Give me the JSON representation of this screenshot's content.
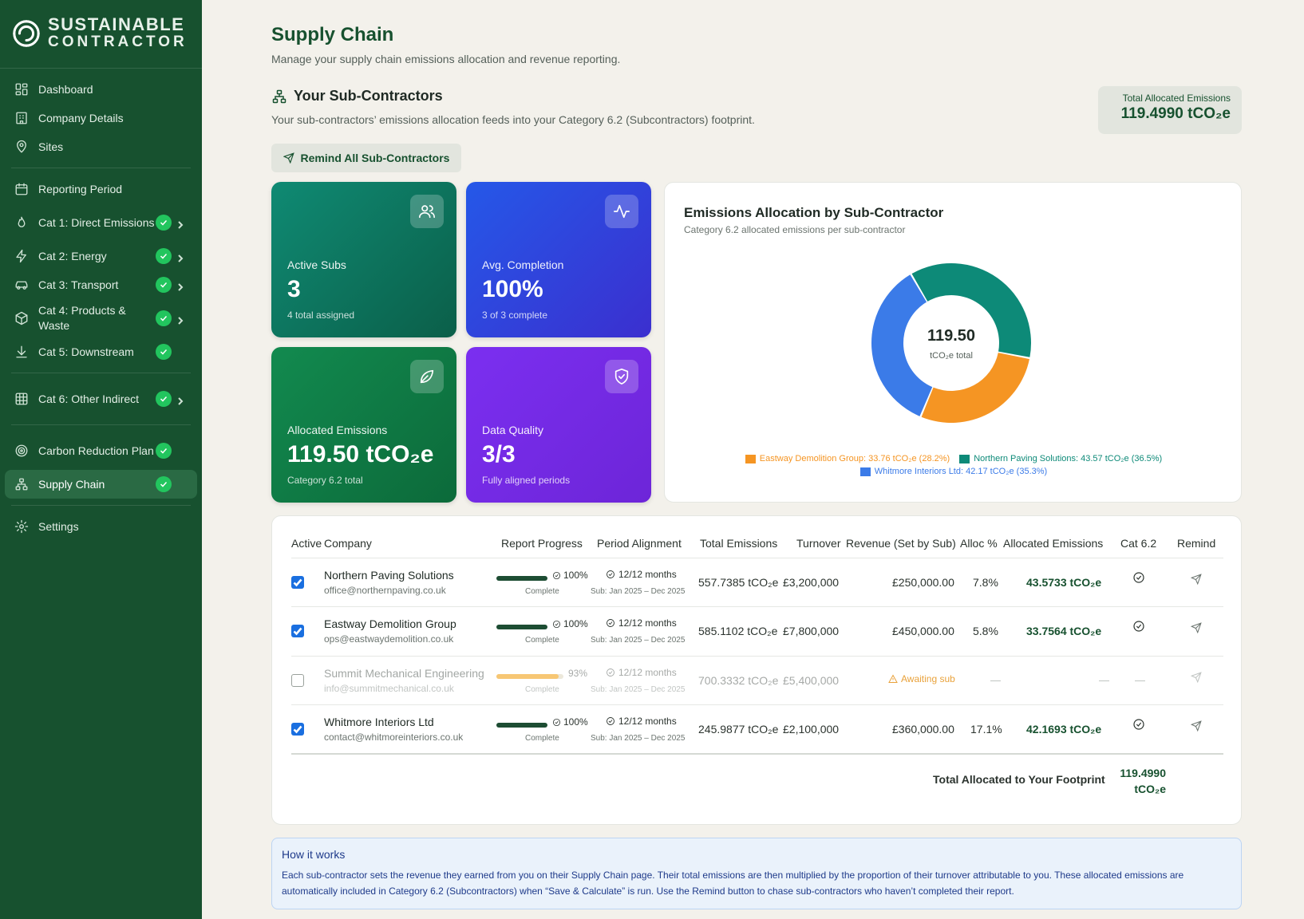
{
  "brand": {
    "line1": "SUSTAINABLE",
    "line2": "CONTRACTOR"
  },
  "sidebar": {
    "items": [
      {
        "label": "Dashboard",
        "icon": "grid-icon"
      },
      {
        "label": "Company Details",
        "icon": "building-icon"
      },
      {
        "label": "Sites",
        "icon": "map-pin-icon"
      },
      {
        "label": "Reporting Period",
        "icon": "calendar-icon"
      },
      {
        "label": "Cat 1: Direct Emissions",
        "icon": "flame-icon",
        "complete": true
      },
      {
        "label": "Cat 2: Energy",
        "icon": "bolt-icon",
        "complete": true
      },
      {
        "label": "Cat 3: Transport",
        "icon": "car-icon",
        "complete": true
      },
      {
        "label": "Cat 4: Products & Waste",
        "icon": "box-icon",
        "complete": true
      },
      {
        "label": "Cat 5: Downstream",
        "icon": "download-icon",
        "complete": true
      },
      {
        "label": "Cat 6: Other Indirect",
        "icon": "table-icon",
        "complete": true
      },
      {
        "label": "Carbon Reduction Plan",
        "icon": "target-icon",
        "complete": true
      },
      {
        "label": "Supply Chain",
        "icon": "network-icon",
        "complete": true,
        "active": true
      },
      {
        "label": "Settings",
        "icon": "gear-icon"
      }
    ]
  },
  "page": {
    "title": "Supply Chain",
    "subtitle": "Manage your supply chain emissions allocation and revenue reporting.",
    "section_title": "Your Sub-Contractors",
    "section_sub": "Your sub-contractors’ emissions allocation feeds into your Category 6.2 (Subcontractors) footprint.",
    "total_label": "Total Allocated Emissions",
    "total_value": "119.4990 tCO₂e",
    "remind_all": "Remind All Sub-Contractors"
  },
  "cards": [
    {
      "label": "Active Subs",
      "value": "3",
      "sub": "4 total assigned",
      "icon": "users-icon"
    },
    {
      "label": "Avg. Completion",
      "value": "100%",
      "sub": "3 of 3 complete",
      "icon": "activity-icon"
    },
    {
      "label": "Allocated Emissions",
      "value": "119.50 tCO₂e",
      "sub": "Category 6.2 total",
      "icon": "leaf-icon"
    },
    {
      "label": "Data Quality",
      "value": "3/3",
      "sub": "Fully aligned periods",
      "icon": "shield-check-icon"
    }
  ],
  "chart_data": {
    "type": "pie",
    "title": "Emissions Allocation by Sub-Contractor",
    "subtitle": "Category 6.2 allocated emissions per sub-contractor",
    "center_value": "119.50",
    "center_label": "tCO₂e total",
    "slices": [
      {
        "name": "Northern Paving Solutions",
        "value": 43.57,
        "pct": 36.5,
        "color": "#0d8a78",
        "legend": "Northern Paving Solutions: 43.57 tCO₂e (36.5%)"
      },
      {
        "name": "Eastway Demolition Group",
        "value": 33.76,
        "pct": 28.2,
        "color": "#f59523",
        "legend": "Eastway Demolition Group: 33.76 tCO₂e (28.2%)"
      },
      {
        "name": "Whitmore Interiors Ltd",
        "value": 42.17,
        "pct": 35.3,
        "color": "#3b7be8",
        "legend": "Whitmore Interiors Ltd: 42.17 tCO₂e (35.3%)"
      }
    ],
    "legend_order": [
      1,
      0,
      2
    ]
  },
  "table": {
    "headers": [
      "Active",
      "Company",
      "Report Progress",
      "Period Alignment",
      "Total Emissions",
      "Turnover",
      "Revenue (Set by Sub)",
      "Alloc %",
      "Allocated Emissions",
      "Cat 6.2",
      "Remind"
    ],
    "rows": [
      {
        "active": true,
        "name": "Northern Paving Solutions",
        "email": "office@northernpaving.co.uk",
        "progress": 1.0,
        "progress_label": "100%",
        "progress_status": "Complete",
        "alignment": "12/12 months",
        "alignment_sub": "Sub: Jan 2025 – Dec 2025",
        "total": "557.7385 tCO₂e",
        "turnover": "£3,200,000",
        "revenue": "£250,000.00",
        "alloc_pct": "7.8%",
        "allocated": "43.5733 tCO₂e"
      },
      {
        "active": true,
        "name": "Eastway Demolition Group",
        "email": "ops@eastwaydemolition.co.uk",
        "progress": 1.0,
        "progress_label": "100%",
        "progress_status": "Complete",
        "alignment": "12/12 months",
        "alignment_sub": "Sub: Jan 2025 – Dec 2025",
        "total": "585.1102 tCO₂e",
        "turnover": "£7,800,000",
        "revenue": "£450,000.00",
        "alloc_pct": "5.8%",
        "allocated": "33.7564 tCO₂e"
      },
      {
        "active": false,
        "name": "Summit Mechanical Engineering",
        "email": "info@summitmechanical.co.uk",
        "progress": 0.93,
        "progress_label": "93%",
        "progress_status": "Complete",
        "alignment": "12/12 months",
        "alignment_sub": "Sub: Jan 2025 – Dec 2025",
        "total": "700.3332 tCO₂e",
        "turnover": "£5,400,000",
        "revenue": "Awaiting sub",
        "alloc_pct": "—",
        "allocated": "—",
        "cat": "—"
      },
      {
        "active": true,
        "name": "Whitmore Interiors Ltd",
        "email": "contact@whitmoreinteriors.co.uk",
        "progress": 1.0,
        "progress_label": "100%",
        "progress_status": "Complete",
        "alignment": "12/12 months",
        "alignment_sub": "Sub: Jan 2025 – Dec 2025",
        "total": "245.9877 tCO₂e",
        "turnover": "£2,100,000",
        "revenue": "£360,000.00",
        "alloc_pct": "17.1%",
        "allocated": "42.1693 tCO₂e"
      }
    ],
    "footer_label": "Total Allocated to Your Footprint",
    "footer_value": "119.4990 tCO₂e"
  },
  "howto": {
    "title": "How it works",
    "body": "Each sub-contractor sets the revenue they earned from you on their Supply Chain page. Their total emissions are then multiplied by the proportion of their turnover attributable to you. These allocated emissions are automatically included in Category 6.2 (Subcontractors) when “Save & Calculate” is run. Use the Remind button to chase sub-contractors who haven’t completed their report."
  }
}
